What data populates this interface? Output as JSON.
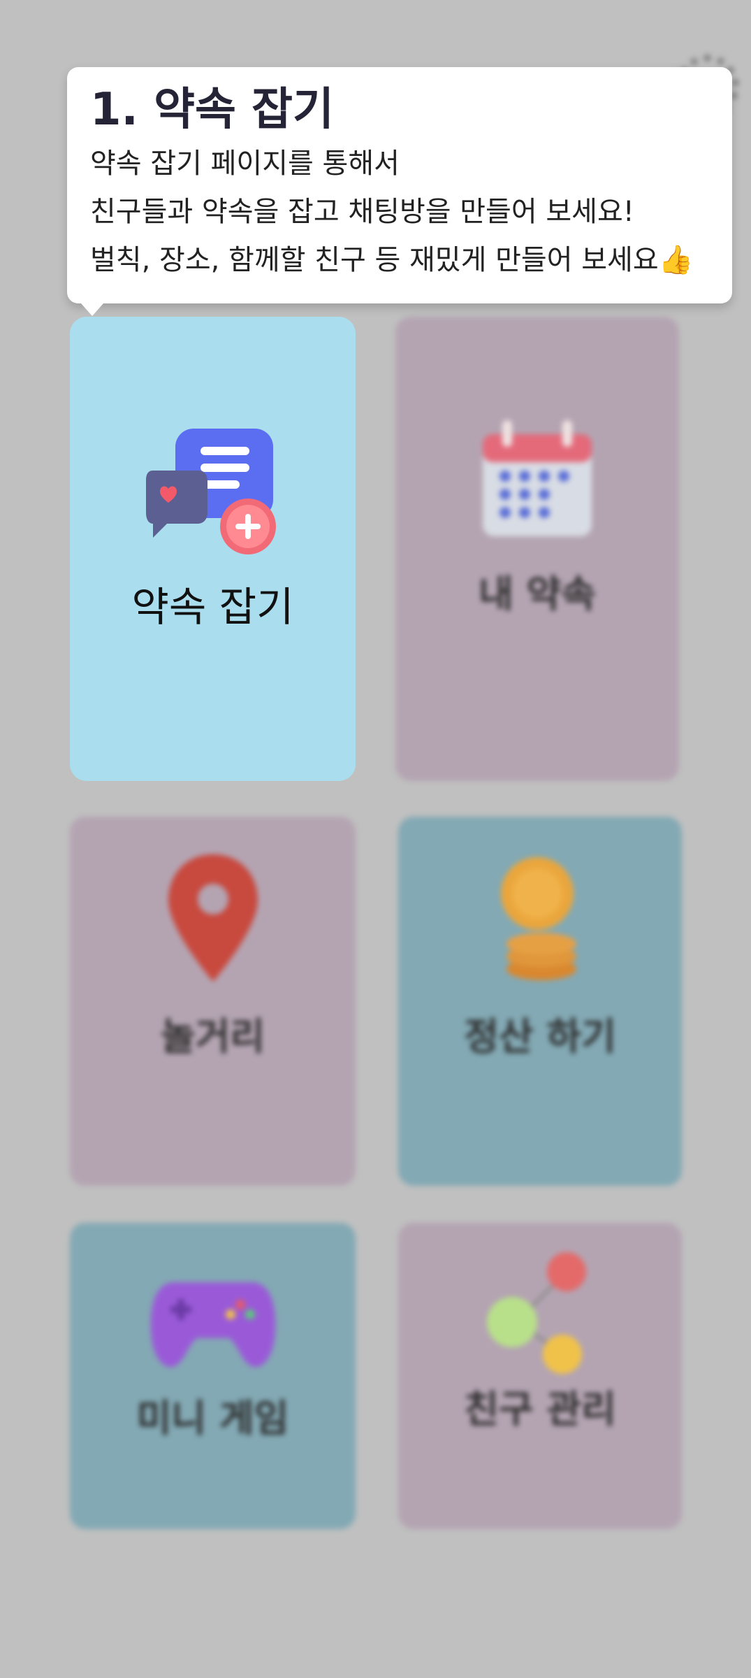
{
  "tooltip": {
    "title": "1. 약속 잡기",
    "lines": [
      "약속 잡기 페이지를 통해서",
      "친구들과 약속을 잡고 채팅방을 만들어 보세요!",
      "벌칙, 장소, 함께할 친구 등 재밌게 만들어 보세요👍"
    ]
  },
  "menu": {
    "appointment": {
      "label": "약속 잡기",
      "icon": "chat-plus-icon"
    },
    "my_appointments": {
      "label": "내 약속",
      "icon": "calendar-icon"
    },
    "places": {
      "label": "놀거리",
      "icon": "map-pin-icon"
    },
    "settlement": {
      "label": "정산 하기",
      "icon": "coins-icon"
    },
    "mini_game": {
      "label": "미니 게임",
      "icon": "gamepad-icon"
    },
    "friends": {
      "label": "친구 관리",
      "icon": "friends-network-icon"
    }
  },
  "colors": {
    "overlay": "#c0c0c0",
    "highlight_card": "#aadded",
    "pink_card": "#b4a4b2",
    "teal_card": "#83a9b4"
  }
}
